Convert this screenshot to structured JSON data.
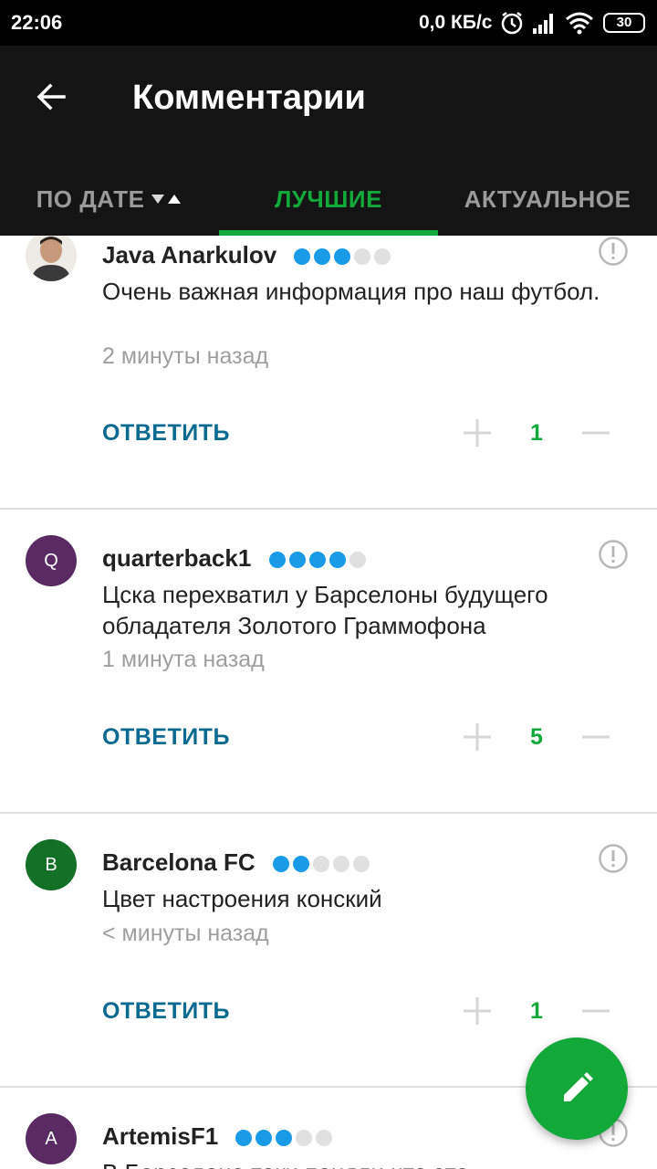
{
  "status_bar": {
    "time": "22:06",
    "network_speed": "0,0 КБ/с",
    "battery": "30"
  },
  "app_bar": {
    "title": "Комментарии"
  },
  "tabs": [
    {
      "label": "ПО ДАТЕ",
      "active": false
    },
    {
      "label": "ЛУЧШИЕ",
      "active": true
    },
    {
      "label": "АКТУАЛЬНОЕ",
      "active": false
    }
  ],
  "colors": {
    "accent": "#13a83a",
    "reply": "#0b6a8f",
    "rating_dot_on": "#1a9be8",
    "rating_dot_off": "#e0e0e0"
  },
  "comments": [
    {
      "username": "Java Anarkulov",
      "avatar_letter": "",
      "avatar_color": "#d9c8b8",
      "rating": 3,
      "rating_max": 5,
      "text": "Очень важная информация про наш футбол.",
      "time": "2 минуты назад",
      "reply_label": "ОТВЕТИТЬ",
      "votes": "1"
    },
    {
      "username": "quarterback1",
      "avatar_letter": "Q",
      "avatar_color": "#5a2a62",
      "rating": 4,
      "rating_max": 5,
      "text": "Цска перехватил у Барселоны будущего обладателя Золотого Граммофона",
      "time": "1 минута назад",
      "reply_label": "ОТВЕТИТЬ",
      "votes": "5"
    },
    {
      "username": "Barcelona FC",
      "avatar_letter": "B",
      "avatar_color": "#137026",
      "rating": 2,
      "rating_max": 5,
      "text": "Цвет настроения конский",
      "time": "< минуты назад",
      "reply_label": "ОТВЕТИТЬ",
      "votes": "1"
    },
    {
      "username": "ArtemisF1",
      "avatar_letter": "A",
      "avatar_color": "#5a2a62",
      "rating": 3,
      "rating_max": 5,
      "text": "В Барселоне таки поняли что это",
      "time": "",
      "reply_label": "",
      "votes": ""
    }
  ],
  "icons": {
    "back": "arrow-back-icon",
    "sort": "sort-arrows-icon",
    "report": "report-icon",
    "plus": "plus-icon",
    "minus": "minus-icon",
    "fab": "pencil-icon"
  }
}
